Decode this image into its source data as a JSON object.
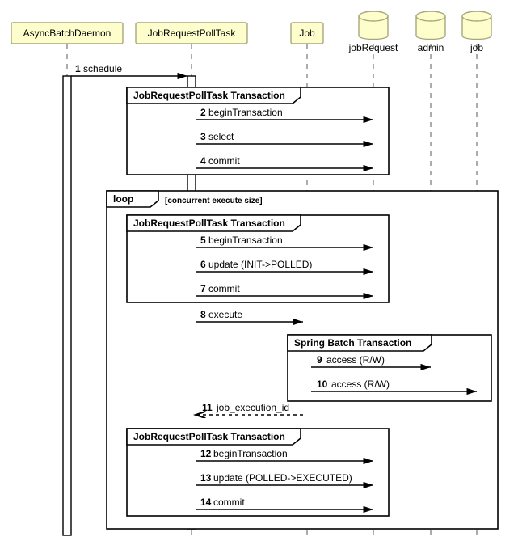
{
  "participants": {
    "p1": "AsyncBatchDaemon",
    "p2": "JobRequestPollTask",
    "p3": "Job",
    "db1": "jobRequest",
    "db2": "admin",
    "db3": "job"
  },
  "frames": {
    "f1": "JobRequestPollTask Transaction",
    "loop": "loop",
    "loop_guard": "[concurrent execute size]",
    "f2": "JobRequestPollTask Transaction",
    "sb": "Spring Batch Transaction",
    "f3": "JobRequestPollTask Transaction"
  },
  "messages": {
    "m1_num": "1",
    "m1": "schedule",
    "m2_num": "2",
    "m2": "beginTransaction",
    "m3_num": "3",
    "m3": "select",
    "m4_num": "4",
    "m4": "commit",
    "m5_num": "5",
    "m5": "beginTransaction",
    "m6_num": "6",
    "m6": "update (INIT->POLLED)",
    "m7_num": "7",
    "m7": "commit",
    "m8_num": "8",
    "m8": "execute",
    "m9_num": "9",
    "m9": "access (R/W)",
    "m10_num": "10",
    "m10": "access (R/W)",
    "m11_num": "11",
    "m11": "job_execution_id",
    "m12_num": "12",
    "m12": "beginTransaction",
    "m13_num": "13",
    "m13": "update (POLLED->EXECUTED)",
    "m14_num": "14",
    "m14": "commit"
  },
  "chart_data": {
    "type": "sequence_diagram",
    "participants": [
      {
        "name": "AsyncBatchDaemon",
        "kind": "component"
      },
      {
        "name": "JobRequestPollTask",
        "kind": "component"
      },
      {
        "name": "Job",
        "kind": "component"
      },
      {
        "name": "jobRequest",
        "kind": "database"
      },
      {
        "name": "admin",
        "kind": "database"
      },
      {
        "name": "job",
        "kind": "database"
      }
    ],
    "interactions": [
      {
        "step": 1,
        "from": "AsyncBatchDaemon",
        "to": "JobRequestPollTask",
        "label": "schedule"
      },
      {
        "frame": "JobRequestPollTask Transaction",
        "steps": [
          {
            "step": 2,
            "from": "JobRequestPollTask",
            "to": "jobRequest",
            "label": "beginTransaction"
          },
          {
            "step": 3,
            "from": "JobRequestPollTask",
            "to": "jobRequest",
            "label": "select"
          },
          {
            "step": 4,
            "from": "JobRequestPollTask",
            "to": "jobRequest",
            "label": "commit"
          }
        ]
      },
      {
        "frame": "loop",
        "guard": "[concurrent execute size]",
        "steps": [
          {
            "frame": "JobRequestPollTask Transaction",
            "steps": [
              {
                "step": 5,
                "from": "JobRequestPollTask",
                "to": "jobRequest",
                "label": "beginTransaction"
              },
              {
                "step": 6,
                "from": "JobRequestPollTask",
                "to": "jobRequest",
                "label": "update (INIT->POLLED)"
              },
              {
                "step": 7,
                "from": "JobRequestPollTask",
                "to": "jobRequest",
                "label": "commit"
              }
            ]
          },
          {
            "step": 8,
            "from": "JobRequestPollTask",
            "to": "Job",
            "label": "execute"
          },
          {
            "frame": "Spring Batch Transaction",
            "steps": [
              {
                "step": 9,
                "from": "Job",
                "to": "admin",
                "label": "access (R/W)"
              },
              {
                "step": 10,
                "from": "Job",
                "to": "job",
                "label": "access (R/W)"
              }
            ]
          },
          {
            "step": 11,
            "from": "Job",
            "to": "JobRequestPollTask",
            "label": "job_execution_id",
            "return": true
          },
          {
            "frame": "JobRequestPollTask Transaction",
            "steps": [
              {
                "step": 12,
                "from": "JobRequestPollTask",
                "to": "jobRequest",
                "label": "beginTransaction"
              },
              {
                "step": 13,
                "from": "JobRequestPollTask",
                "to": "jobRequest",
                "label": "update (POLLED->EXECUTED)"
              },
              {
                "step": 14,
                "from": "JobRequestPollTask",
                "to": "jobRequest",
                "label": "commit"
              }
            ]
          }
        ]
      }
    ]
  }
}
